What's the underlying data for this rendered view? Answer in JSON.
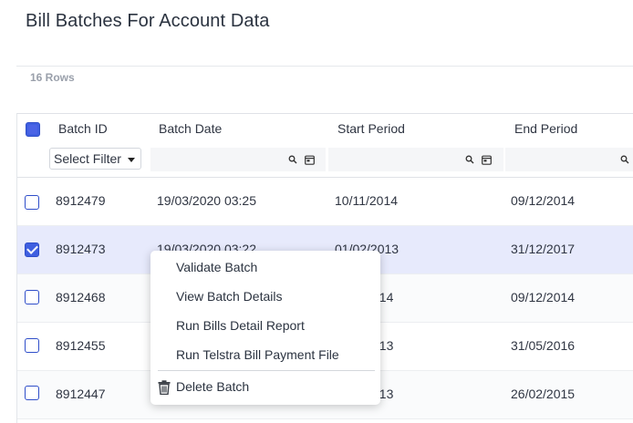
{
  "page": {
    "title": "Bill Batches For Account Data"
  },
  "grid": {
    "row_count_label": "16 Rows",
    "columns": {
      "batch_id": "Batch ID",
      "batch_date": "Batch Date",
      "start_period": "Start Period",
      "end_period": "End Period"
    },
    "filter": {
      "select_placeholder": "Select Filter"
    },
    "rows": [
      {
        "batch_id": "8912479",
        "batch_date": "19/03/2020 03:25",
        "start_period": "10/11/2014",
        "end_period": "09/12/2014",
        "checked": false
      },
      {
        "batch_id": "8912473",
        "batch_date": "19/03/2020 03:22",
        "start_period": "01/02/2013",
        "end_period": "31/12/2017",
        "checked": true
      },
      {
        "batch_id": "8912468",
        "batch_date": "",
        "start_period": "014",
        "end_period": "09/12/2014",
        "checked": false
      },
      {
        "batch_id": "8912455",
        "batch_date": "",
        "start_period": "013",
        "end_period": "31/05/2016",
        "checked": false
      },
      {
        "batch_id": "8912447",
        "batch_date": "",
        "start_period": "013",
        "end_period": "26/02/2015",
        "checked": false
      }
    ]
  },
  "context_menu": {
    "items": [
      "Validate Batch",
      "View Batch Details",
      "Run Bills Detail Report",
      "Run Telstra Bill Payment File"
    ],
    "delete_label": "Delete Batch"
  },
  "colors": {
    "accent": "#3f5fe0",
    "selected_row": "#e7eafc"
  }
}
